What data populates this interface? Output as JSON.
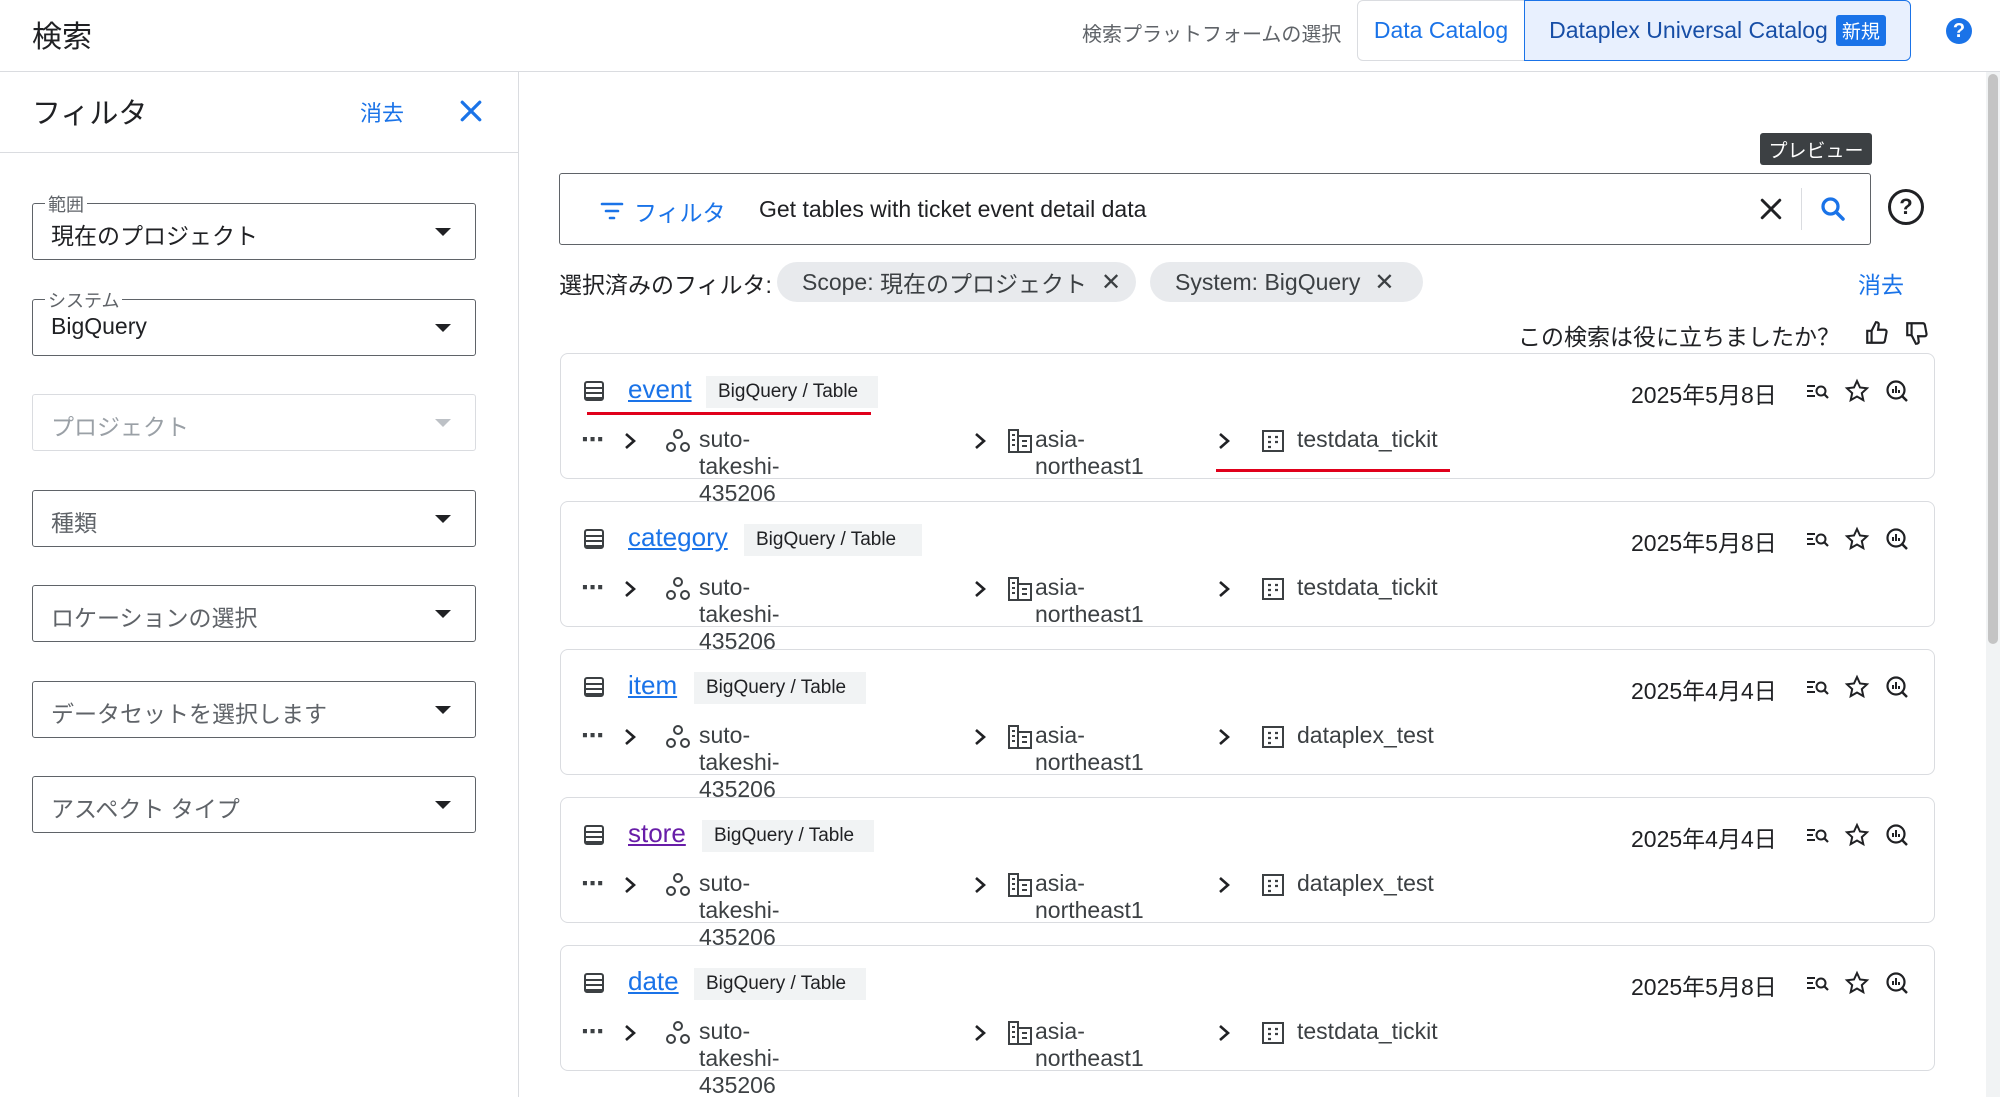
{
  "header": {
    "title": "検索",
    "platform_label": "検索プラットフォームの選択",
    "tabs": [
      {
        "label": "Data Catalog",
        "selected": false
      },
      {
        "label": "Dataplex Universal Catalog",
        "badge": "新規",
        "selected": true
      }
    ],
    "help": "?"
  },
  "filter_panel": {
    "title": "フィルタ",
    "clear_label": "消去",
    "fields": [
      {
        "label": "範囲",
        "value": "現在のプロジェクト"
      },
      {
        "label": "システム",
        "value": "BigQuery"
      },
      {
        "placeholder": "プロジェクト",
        "disabled": true
      },
      {
        "placeholder": "種類"
      },
      {
        "placeholder": "ロケーションの選択"
      },
      {
        "placeholder": "データセットを選択します"
      },
      {
        "placeholder": "アスペクト タイプ"
      }
    ]
  },
  "search": {
    "tooltip": "プレビュー",
    "filter_label": "フィルタ",
    "query": "Get tables with ticket event detail data",
    "help": "?",
    "selected_filters_label": "選択済みのフィルタ:",
    "chips": [
      {
        "key": "Scope:",
        "value": "現在のプロジェクト"
      },
      {
        "key": "System:",
        "value": "BigQuery"
      }
    ],
    "clear_label": "消去",
    "feedback_question": "この検索は役に立ちましたか？"
  },
  "results": [
    {
      "name": "event",
      "type": "BigQuery / Table",
      "date": "2025年5月8日",
      "project": "suto-takeshi-435206",
      "location": "asia-northeast1",
      "dataset": "testdata_tickit",
      "ellipsis": "⋯"
    },
    {
      "name": "category",
      "type": "BigQuery / Table",
      "date": "2025年5月8日",
      "project": "suto-takeshi-435206",
      "location": "asia-northeast1",
      "dataset": "testdata_tickit",
      "ellipsis": "⋯"
    },
    {
      "name": "item",
      "type": "BigQuery / Table",
      "date": "2025年4月4日",
      "project": "suto-takeshi-435206",
      "location": "asia-northeast1",
      "dataset": "dataplex_test",
      "ellipsis": "⋯"
    },
    {
      "name": "store",
      "type": "BigQuery / Table",
      "date": "2025年4月4日",
      "project": "suto-takeshi-435206",
      "location": "asia-northeast1",
      "dataset": "dataplex_test",
      "ellipsis": "⋯"
    },
    {
      "name": "date",
      "type": "BigQuery / Table",
      "date": "2025年5月8日",
      "project": "suto-takeshi-435206",
      "location": "asia-northeast1",
      "dataset": "testdata_tickit",
      "ellipsis": "⋯"
    }
  ],
  "colors": {
    "accent": "#1a73e8",
    "visited": "#681da8",
    "annotation": "#e0001b"
  }
}
